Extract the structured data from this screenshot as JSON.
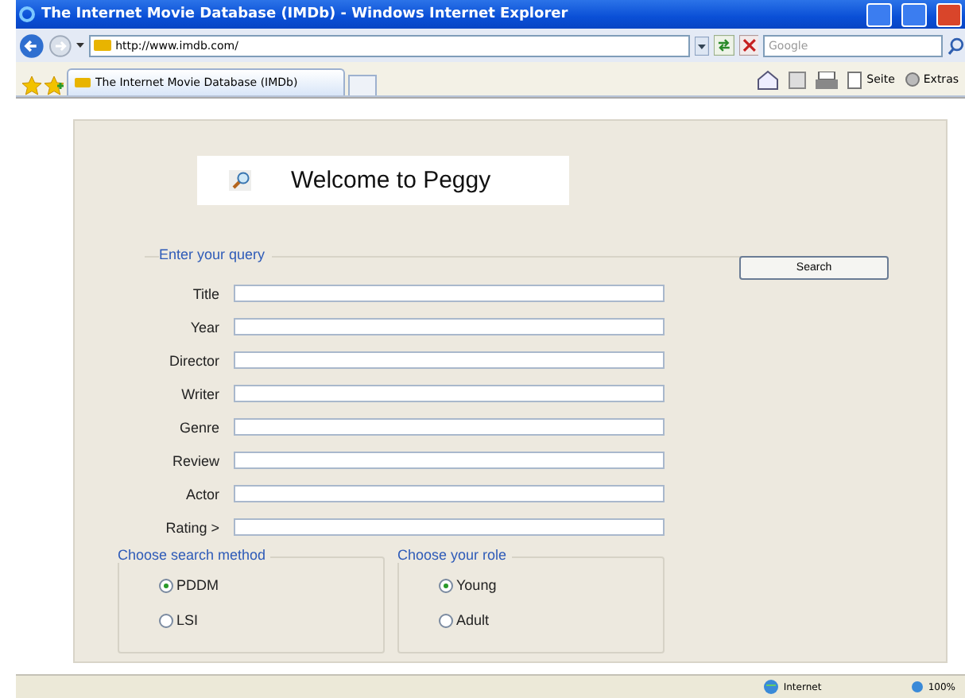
{
  "window": {
    "title": "The Internet Movie Database (IMDb) - Windows Internet Explorer"
  },
  "address_bar": {
    "url": "http://www.imdb.com/"
  },
  "search_box": {
    "placeholder": "Google"
  },
  "tabs": [
    {
      "label": "The Internet Movie Database (IMDb)",
      "selected": true
    }
  ],
  "toolbar": [
    "Seite",
    "Extras"
  ],
  "page": {
    "welcome": "Welcome to Peggy",
    "query_legend": "Enter your query",
    "search_button": "Search",
    "fields": [
      {
        "label": "Title"
      },
      {
        "label": "Year"
      },
      {
        "label": "Director"
      },
      {
        "label": "Writer"
      },
      {
        "label": "Genre"
      },
      {
        "label": "Review"
      },
      {
        "label": "Actor"
      },
      {
        "label": "Rating >"
      }
    ],
    "groups": [
      {
        "legend": "Choose search method",
        "options": [
          {
            "label": "PDDM",
            "selected": true
          },
          {
            "label": "LSI",
            "selected": false
          }
        ]
      },
      {
        "legend": "Choose your role",
        "options": [
          {
            "label": "Young",
            "selected": true
          },
          {
            "label": "Adult",
            "selected": false
          }
        ]
      }
    ]
  },
  "status_bar": {
    "zone": "Internet",
    "zoom": "100%"
  }
}
